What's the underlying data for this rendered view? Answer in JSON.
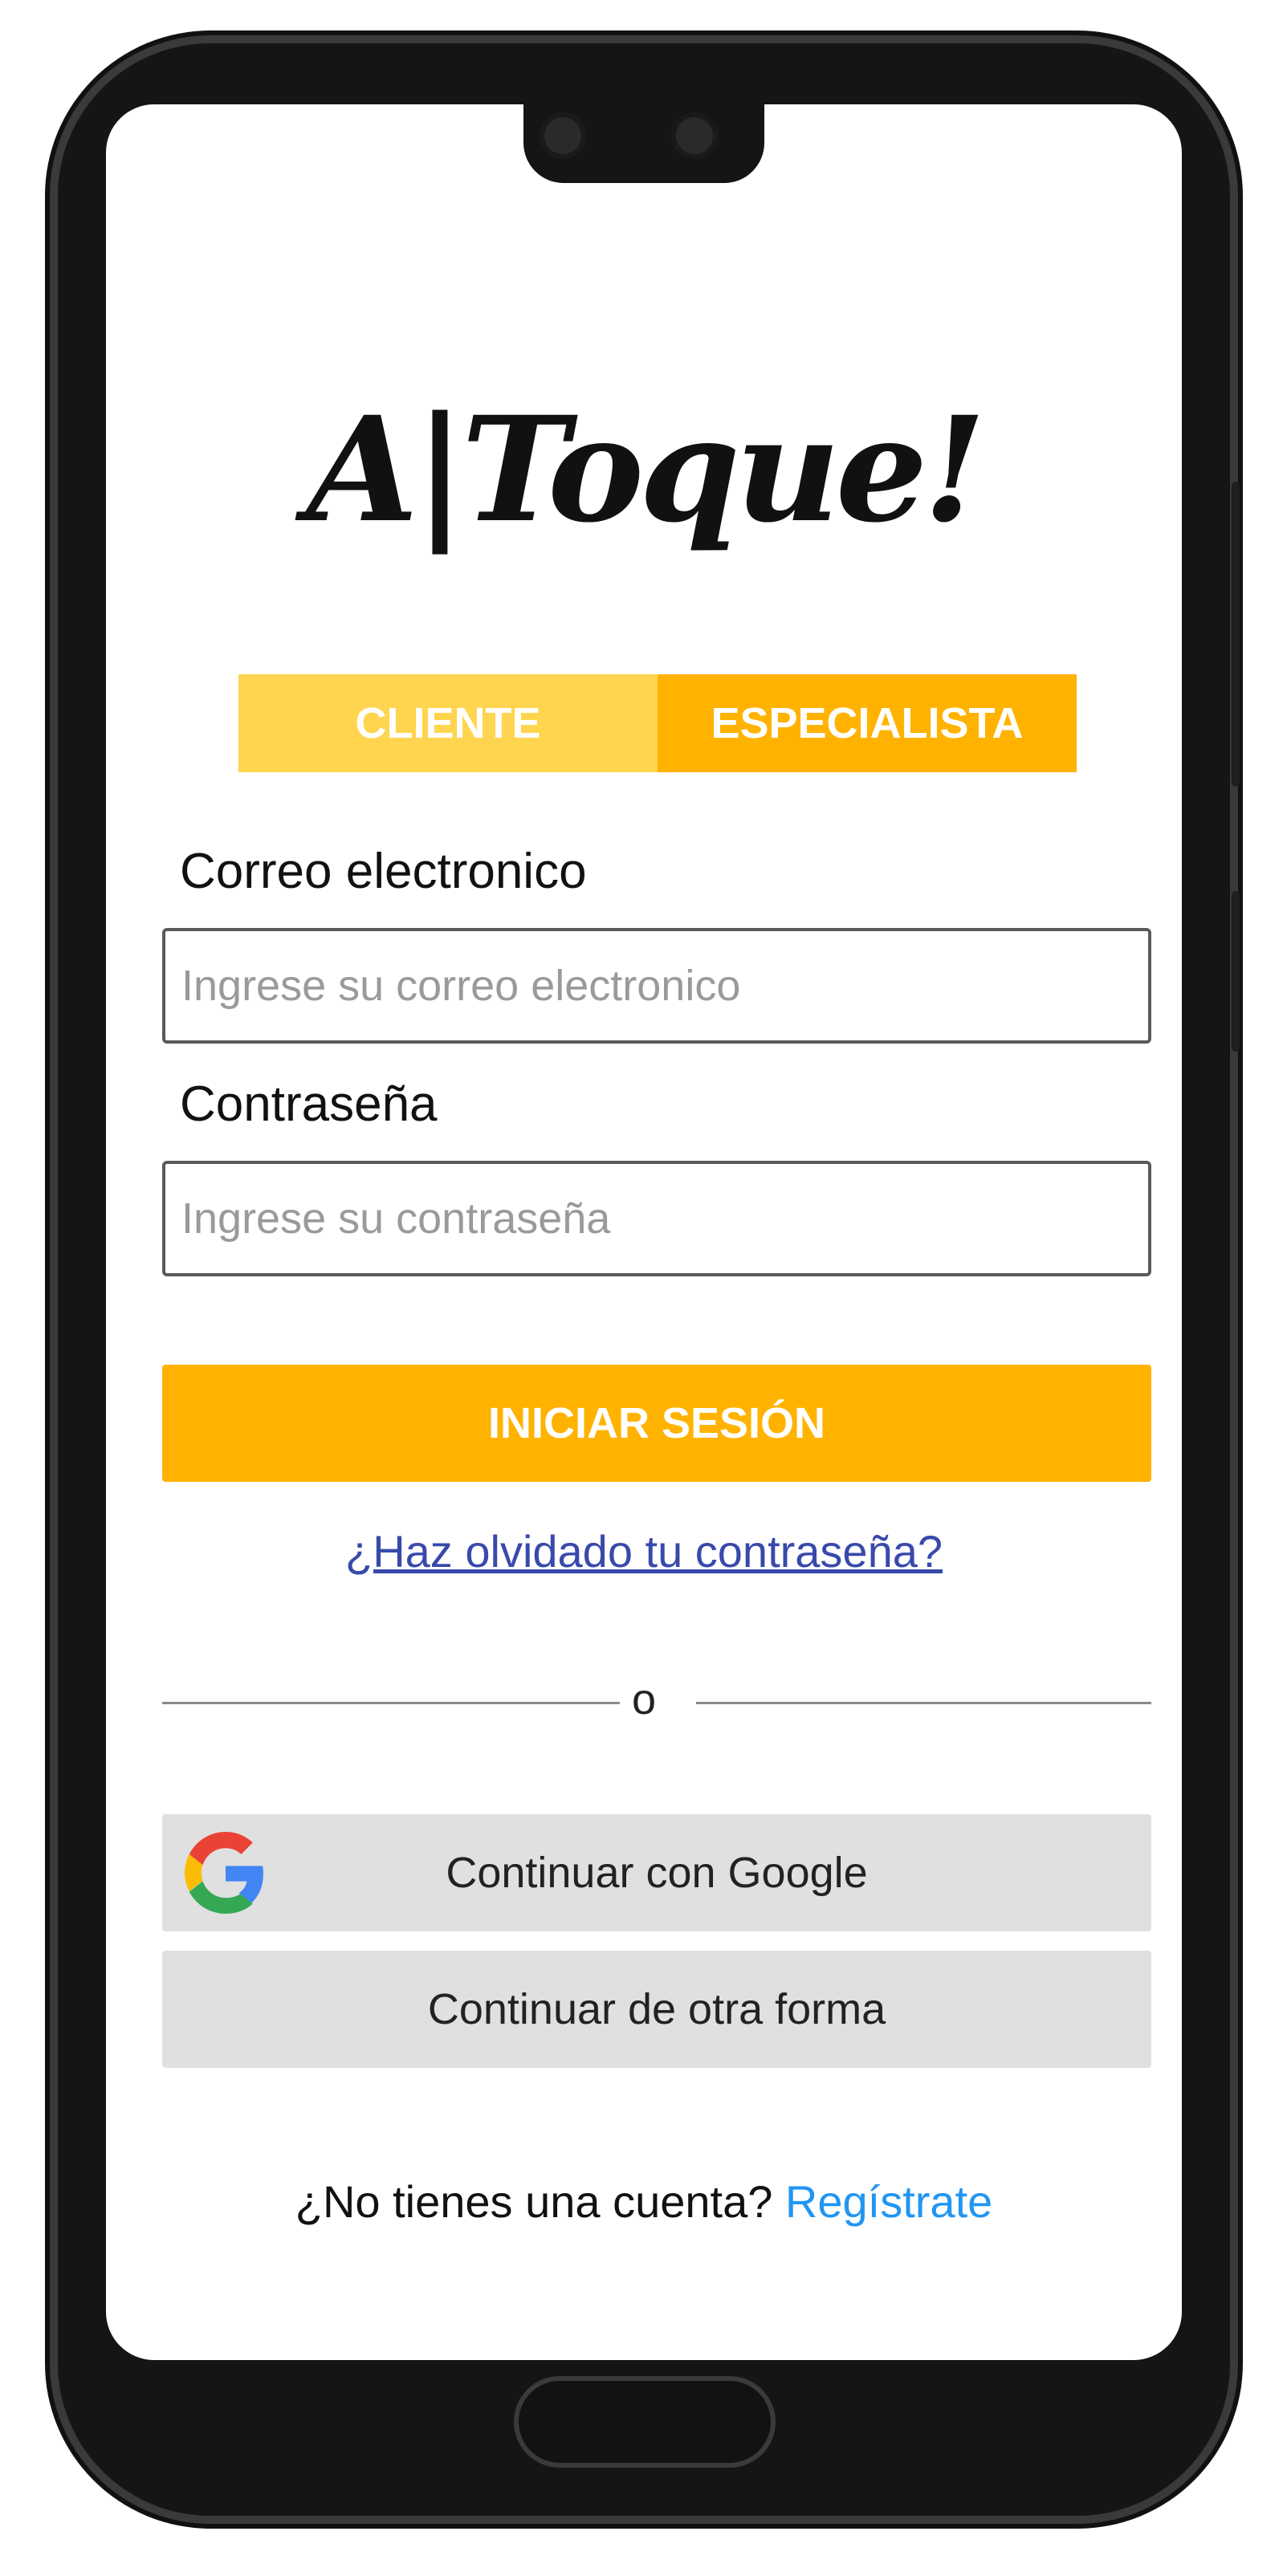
{
  "app": {
    "logo_text": "A|Toque!"
  },
  "tabs": [
    {
      "label": "CLIENTE"
    },
    {
      "label": "ESPECIALISTA"
    }
  ],
  "form": {
    "email_label": "Correo electronico",
    "email_placeholder": "Ingrese su correo electronico",
    "password_label": "Contraseña",
    "password_placeholder": "Ingrese su contraseña",
    "login_label": "INICIAR SESIÓN",
    "forgot_label": "¿Haz olvidado tu contraseña?"
  },
  "divider": {
    "text": "o"
  },
  "social": {
    "google_label": "Continuar con Google",
    "other_label": "Continuar de otra forma"
  },
  "signup": {
    "prompt": "¿No tienes una cuenta?",
    "link": "Regístrate"
  },
  "colors": {
    "primary": "#ffb300",
    "tab_inactive": "#ffd54f",
    "link": "#3949ab",
    "signup_link": "#2196f3",
    "social_bg": "#e0e0e0"
  },
  "icons": {
    "google": "google-g-icon"
  }
}
